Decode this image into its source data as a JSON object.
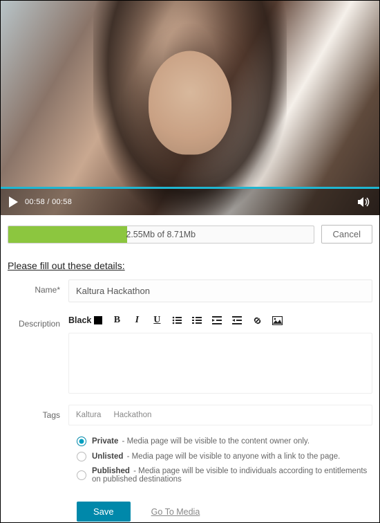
{
  "video": {
    "current_time": "00:58",
    "duration": "00:58",
    "timecode_display": "00:58 / 00:58",
    "seek_percent": 100
  },
  "upload": {
    "uploaded_mb": "2.55Mb",
    "total_mb": "8.71Mb",
    "progress_text": "2.55Mb of 8.71Mb",
    "progress_percent": 39,
    "cancel_label": "Cancel"
  },
  "section_title": "Please fill out these details:",
  "form": {
    "name_label": "Name*",
    "name_value": "Kaltura Hackathon",
    "description_label": "Description",
    "tags_label": "Tags",
    "tags": [
      "Kaltura",
      "Hackathon"
    ]
  },
  "editor_toolbar": {
    "font_color_label": "Black"
  },
  "visibility": {
    "selected": "private",
    "options": [
      {
        "key": "private",
        "label": "Private",
        "hint": " - Media page will be visible to the content owner only."
      },
      {
        "key": "unlisted",
        "label": "Unlisted",
        "hint": " - Media page will be visible to anyone with a link to the page."
      },
      {
        "key": "published",
        "label": "Published",
        "hint": " - Media page will be visible to individuals according to entitlements on published destinations"
      }
    ]
  },
  "actions": {
    "save_label": "Save",
    "goto_media_label": "Go To Media"
  }
}
